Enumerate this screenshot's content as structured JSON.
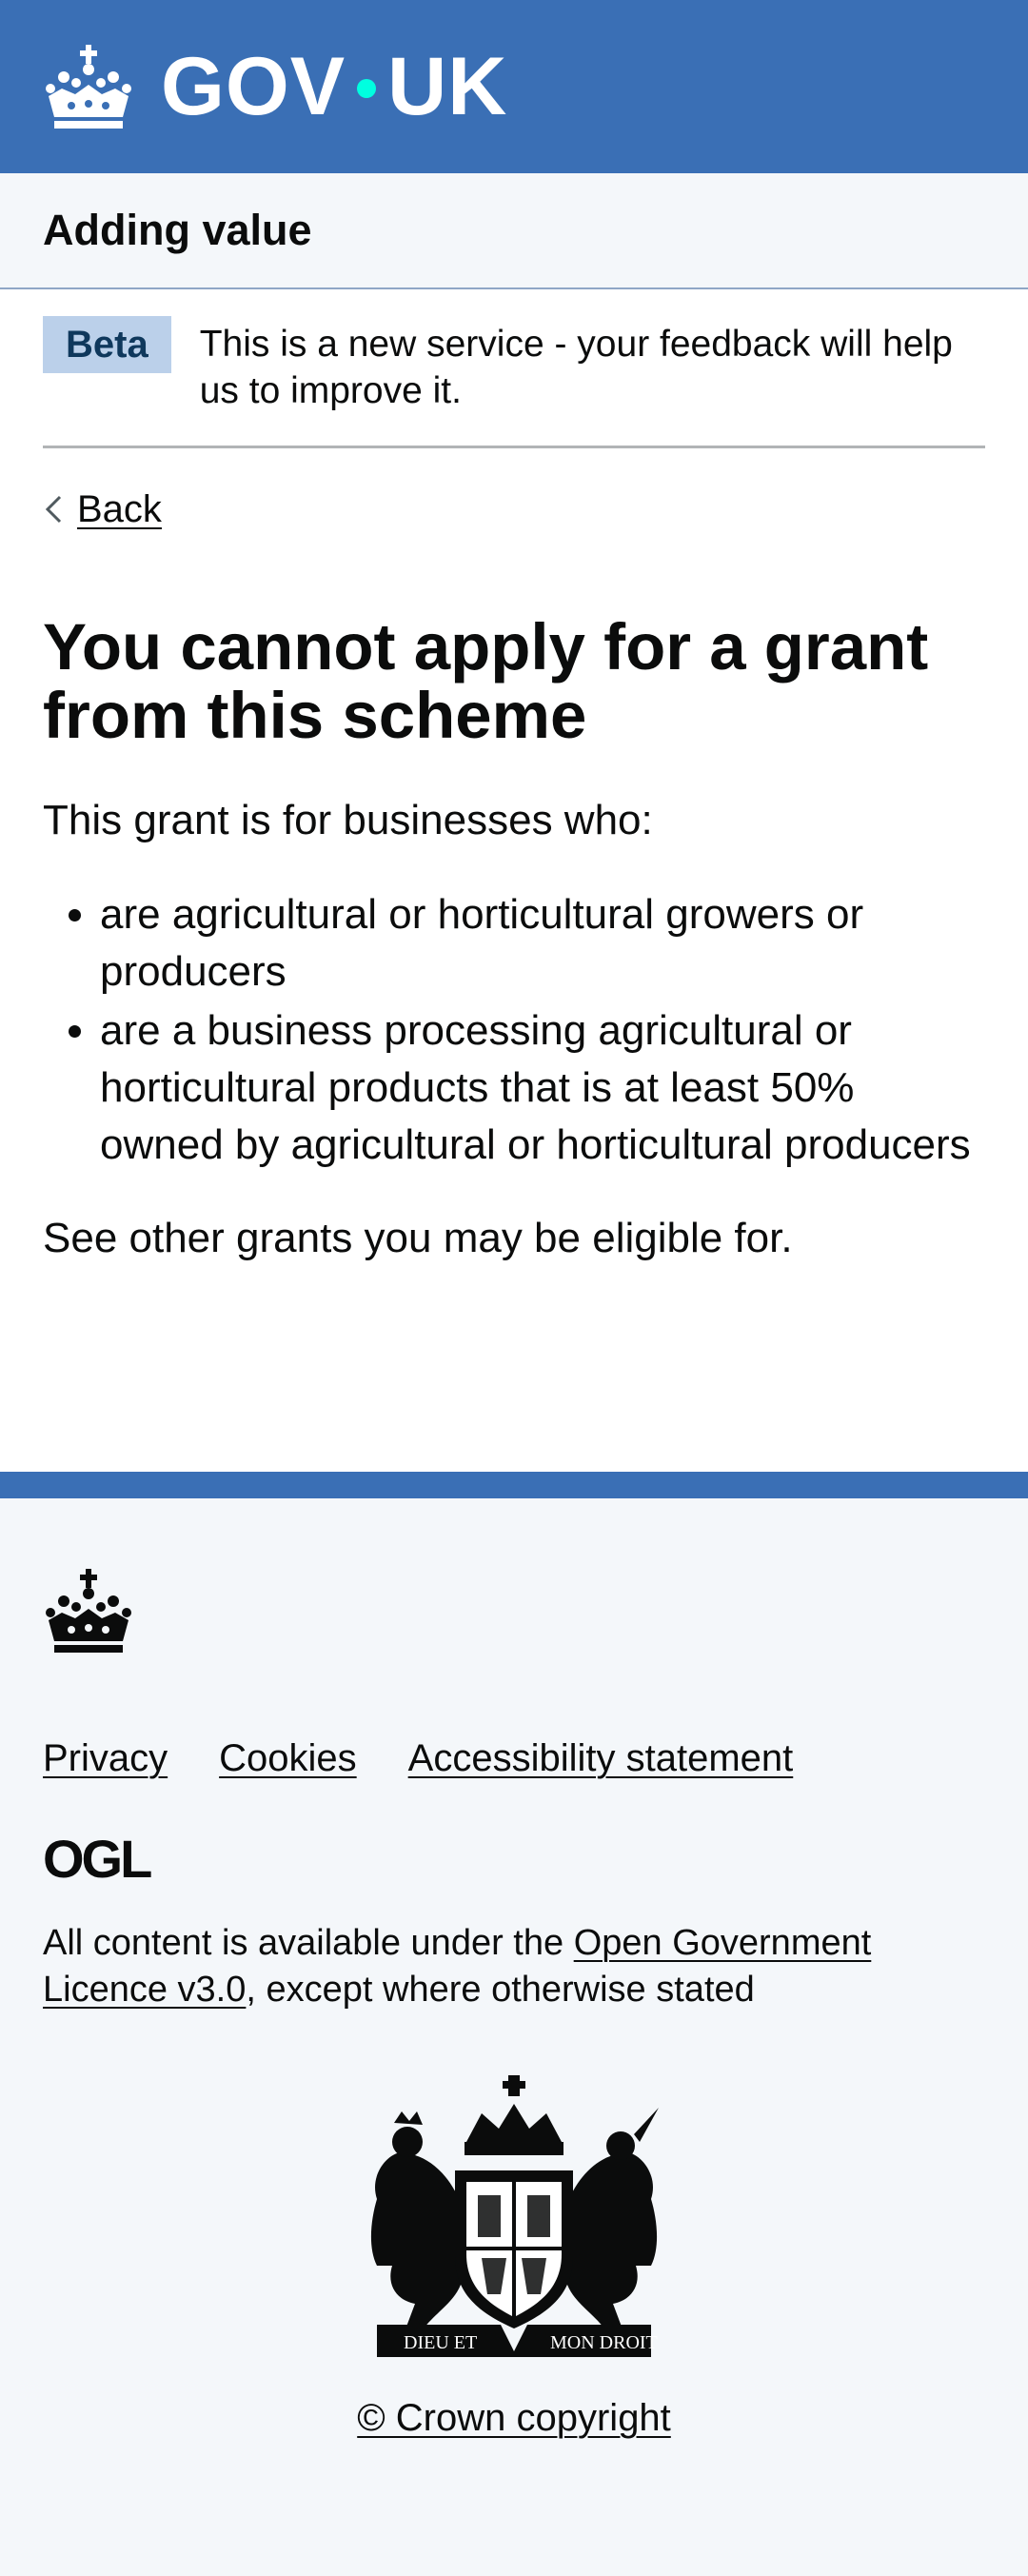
{
  "header": {
    "logo_text_left": "GOV",
    "logo_text_right": "UK",
    "crown_icon": "crown-icon"
  },
  "service": {
    "name": "Adding value"
  },
  "phase_banner": {
    "tag": "Beta",
    "text": "This is a new service - your feedback will help us to improve it."
  },
  "back_link": {
    "label": "Back"
  },
  "main": {
    "title": "You cannot apply for a grant from this scheme",
    "intro": "This grant is for businesses who:",
    "criteria": [
      "are agricultural or horticultural growers or producers",
      "are a business processing agricultural or horticultural products that is at least 50% owned by agricultural or horticultural producers"
    ],
    "other_grants": "See other grants you may be eligible for."
  },
  "footer": {
    "links": [
      "Privacy",
      "Cookies",
      "Accessibility statement"
    ],
    "licence_before": "All content is available under the ",
    "licence_link": "Open Government Licence v3.0",
    "licence_after": ", except where otherwise stated",
    "ogl_logo_text": "OGL",
    "copyright": "© Crown copyright",
    "coat_motto_left": "DIEU ET",
    "coat_motto_right": "MON DROIT"
  },
  "colors": {
    "header_blue": "#3a6fb5",
    "logo_dot": "#00ffe0",
    "beta_tag_bg": "#bbd0ea",
    "footer_bg": "#f4f7fa"
  }
}
